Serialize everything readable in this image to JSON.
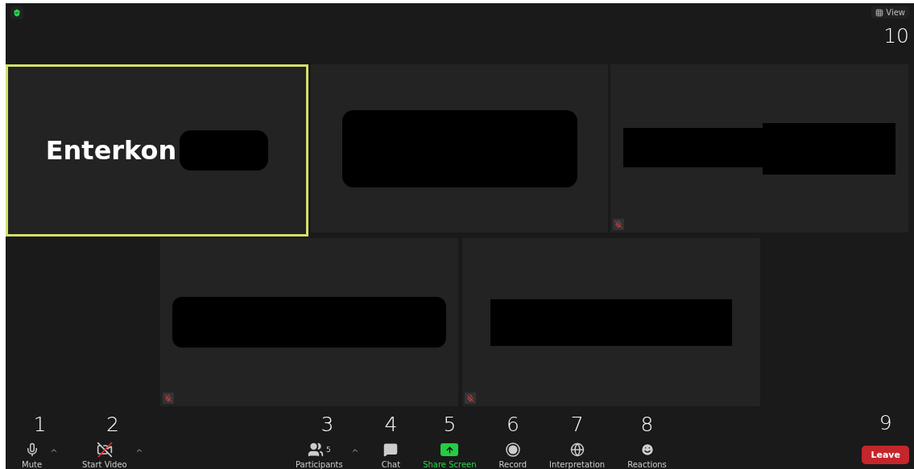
{
  "top_bar": {
    "secure": true,
    "view_button": {
      "label": "View",
      "marker": "10"
    }
  },
  "tiles": [
    {
      "name": "Enterkon",
      "active": true,
      "muted": false,
      "kind": "pill"
    },
    {
      "active": false,
      "muted": false,
      "kind": "box"
    },
    {
      "active": false,
      "muted": true,
      "kind": "split"
    },
    {
      "active": false,
      "muted": true,
      "kind": "banner"
    },
    {
      "active": false,
      "muted": true,
      "kind": "bar"
    }
  ],
  "left_controls": [
    {
      "kind": "mute",
      "label": "Mute",
      "marker": "1",
      "caret": true
    },
    {
      "kind": "video",
      "label": "Start Video",
      "marker": "2",
      "caret": true,
      "off": true
    }
  ],
  "center_controls": [
    {
      "kind": "participants",
      "label": "Participants",
      "marker": "3",
      "count": "5",
      "caret": true
    },
    {
      "kind": "chat",
      "label": "Chat",
      "marker": "4"
    },
    {
      "kind": "share",
      "label": "Share Screen",
      "marker": "5",
      "highlighted": true
    },
    {
      "kind": "record",
      "label": "Record",
      "marker": "6"
    },
    {
      "kind": "interpretation",
      "label": "Interpretation",
      "marker": "7"
    },
    {
      "kind": "reactions",
      "label": "Reactions",
      "marker": "8"
    }
  ],
  "leave": {
    "label": "Leave",
    "marker": "9"
  }
}
